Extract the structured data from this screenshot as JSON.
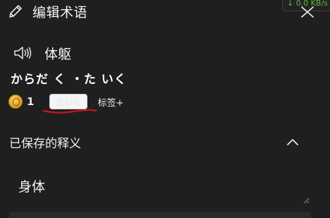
{
  "network": {
    "speed": "↓ 0.0 KB/s"
  },
  "header": {
    "title": "编辑术语",
    "icon": "pencil-icon",
    "close_icon": "close-icon"
  },
  "term": {
    "word": "体躯",
    "reading": "からだ く ・た いく",
    "speaker_icon": "speaker-icon"
  },
  "meta": {
    "coin_icon": "coin-icon",
    "coin_count": "1",
    "tag": "たいく",
    "add_tag_label": "标签+"
  },
  "saved_section": {
    "title": "已保存的释义",
    "toggle_icon": "chevron-up-icon",
    "meanings": [
      "身体"
    ]
  },
  "colors": {
    "background": "#1f1f1f",
    "text": "#f2f2f2",
    "network_green": "#5dbb3f",
    "annotation_red": "#d01515",
    "tag_bg": "#f5f5f5"
  }
}
